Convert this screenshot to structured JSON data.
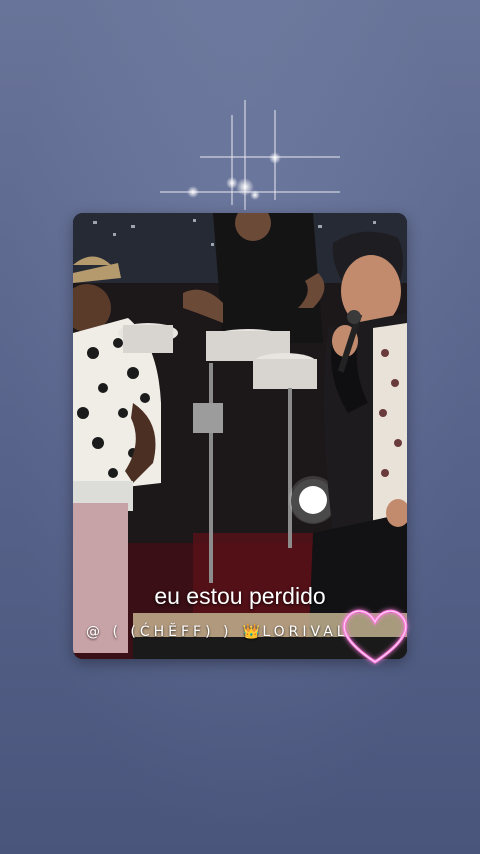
{
  "story": {
    "caption": "eu estou perdido",
    "handle_prefix": "@ ( (ĆHĔFF) ) ",
    "handle_crown": "👑",
    "handle_suffix": "LORIVAL"
  },
  "colors": {
    "background_top": "#6e7aa1",
    "background_bottom": "#4d5a82",
    "heart_glow": "#ff7de0",
    "caption_text": "#ffffff"
  },
  "icons": {
    "sparkle": "sparkle-icon",
    "heart": "heart-icon",
    "crown": "crown-icon"
  }
}
